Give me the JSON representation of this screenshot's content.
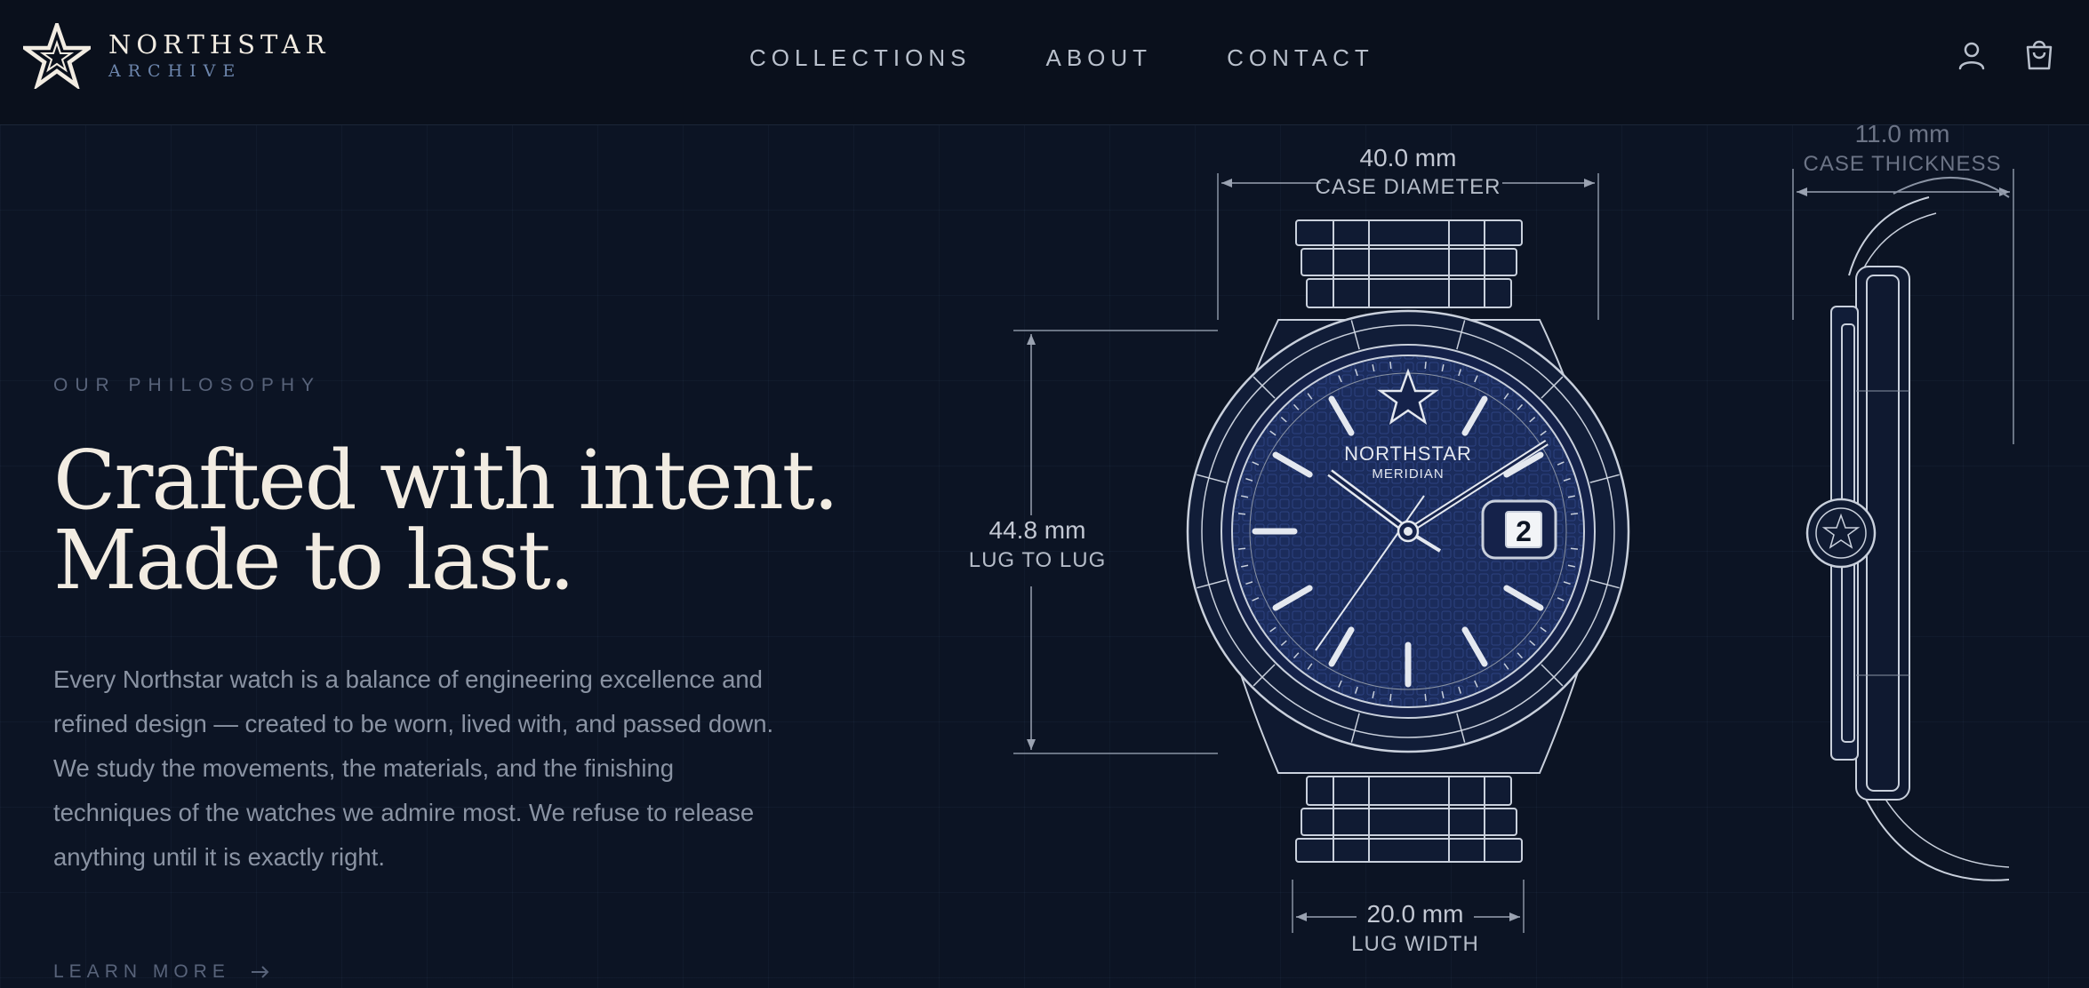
{
  "brand": {
    "name": "NORTHSTAR",
    "sub": "ARCHIVE"
  },
  "nav": {
    "items": [
      {
        "label": "COLLECTIONS"
      },
      {
        "label": "ABOUT"
      },
      {
        "label": "CONTACT"
      }
    ]
  },
  "header_icons": [
    "user-icon",
    "shopping-bag-icon"
  ],
  "hero": {
    "eyebrow": "OUR PHILOSOPHY",
    "title_lines": [
      "Crafted with intent.",
      "Made to last."
    ],
    "description_lines": [
      "Every Northstar watch is a balance of engineering excellence and",
      "refined design — created to be worn, lived with, and passed down.",
      "We study the movements, the materials, and the finishing",
      "techniques of the watches we admire most. We refuse to release",
      "anything until it is exactly right."
    ],
    "cta": "LEARN MORE"
  },
  "drawing": {
    "dial_brand": "NORTHSTAR",
    "dial_model": "MERIDIAN",
    "date": "2",
    "dimensions": {
      "case_diameter": {
        "value": "40.0 mm",
        "label": "CASE DIAMETER"
      },
      "lug_to_lug": {
        "value": "44.8 mm",
        "label": "LUG TO LUG"
      },
      "lug_width": {
        "value": "20.0 mm",
        "label": "LUG WIDTH"
      },
      "case_thickness": {
        "value": "11.0 mm",
        "label": "CASE THICKNESS"
      }
    }
  },
  "colors": {
    "background": "#0c1424",
    "header": "#0a101c",
    "text": "#f2ece2",
    "muted": "#8a93a3",
    "accent": "#6d86ad",
    "dial": "#1b2c5c",
    "line": "#c9d0dc"
  }
}
